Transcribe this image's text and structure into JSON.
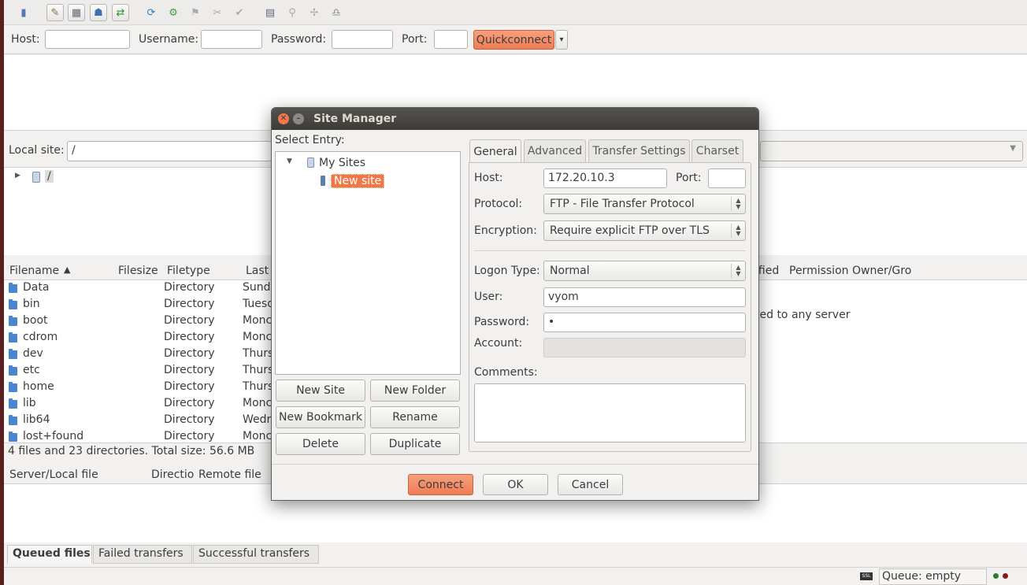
{
  "quickconnect": {
    "host_label": "Host:",
    "username_label": "Username:",
    "password_label": "Password:",
    "port_label": "Port:",
    "button": "Quickconnect",
    "dropdown_glyph": "▾"
  },
  "local": {
    "label": "Local site:",
    "path": "/",
    "tree_root": "/"
  },
  "columns": [
    "Filename",
    "Filesize",
    "Filetype",
    "Last"
  ],
  "remote_columns": [
    "ified",
    "Permission",
    "Owner/Gro"
  ],
  "remote_status": "ted to any server",
  "files": [
    {
      "name": "Data",
      "type": "Directory",
      "modified": "Sunda"
    },
    {
      "name": "bin",
      "type": "Directory",
      "modified": "Tuesd"
    },
    {
      "name": "boot",
      "type": "Directory",
      "modified": "Monc"
    },
    {
      "name": "cdrom",
      "type": "Directory",
      "modified": "Monc"
    },
    {
      "name": "dev",
      "type": "Directory",
      "modified": "Thurs"
    },
    {
      "name": "etc",
      "type": "Directory",
      "modified": "Thurs"
    },
    {
      "name": "home",
      "type": "Directory",
      "modified": "Thurs"
    },
    {
      "name": "lib",
      "type": "Directory",
      "modified": "Monc"
    },
    {
      "name": "lib64",
      "type": "Directory",
      "modified": "Wedr"
    },
    {
      "name": "lost+found",
      "type": "Directory",
      "modified": "Monc"
    }
  ],
  "summary": "4 files and 23 directories. Total size: 56.6 MB",
  "queue_columns": [
    "Server/Local file",
    "Directio",
    "Remote file"
  ],
  "queue_tabs": [
    "Queued files",
    "Failed transfers",
    "Successful transfers"
  ],
  "queue_status": "Queue: empty",
  "dialog": {
    "title": "Site Manager",
    "select_entry": "Select Entry:",
    "tree_root": "My Sites",
    "tree_child": "New site",
    "buttons": {
      "new_site": "New Site",
      "new_folder": "New Folder",
      "new_bookmark": "New Bookmark",
      "rename": "Rename",
      "delete": "Delete",
      "duplicate": "Duplicate",
      "connect": "Connect",
      "ok": "OK",
      "cancel": "Cancel"
    },
    "tabs": [
      "General",
      "Advanced",
      "Transfer Settings",
      "Charset"
    ],
    "general": {
      "host_label": "Host:",
      "host": "172.20.10.3",
      "port_label": "Port:",
      "port": "",
      "protocol_label": "Protocol:",
      "protocol": "FTP - File Transfer Protocol",
      "encryption_label": "Encryption:",
      "encryption": "Require explicit FTP over TLS",
      "logon_label": "Logon Type:",
      "logon": "Normal",
      "user_label": "User:",
      "user": "vyom",
      "password_label": "Password:",
      "password": "•",
      "account_label": "Account:",
      "comments_label": "Comments:"
    }
  },
  "colors": {
    "accent": "#ee7c54",
    "selection": "#f07746",
    "titlebar": "#3c3b37"
  }
}
